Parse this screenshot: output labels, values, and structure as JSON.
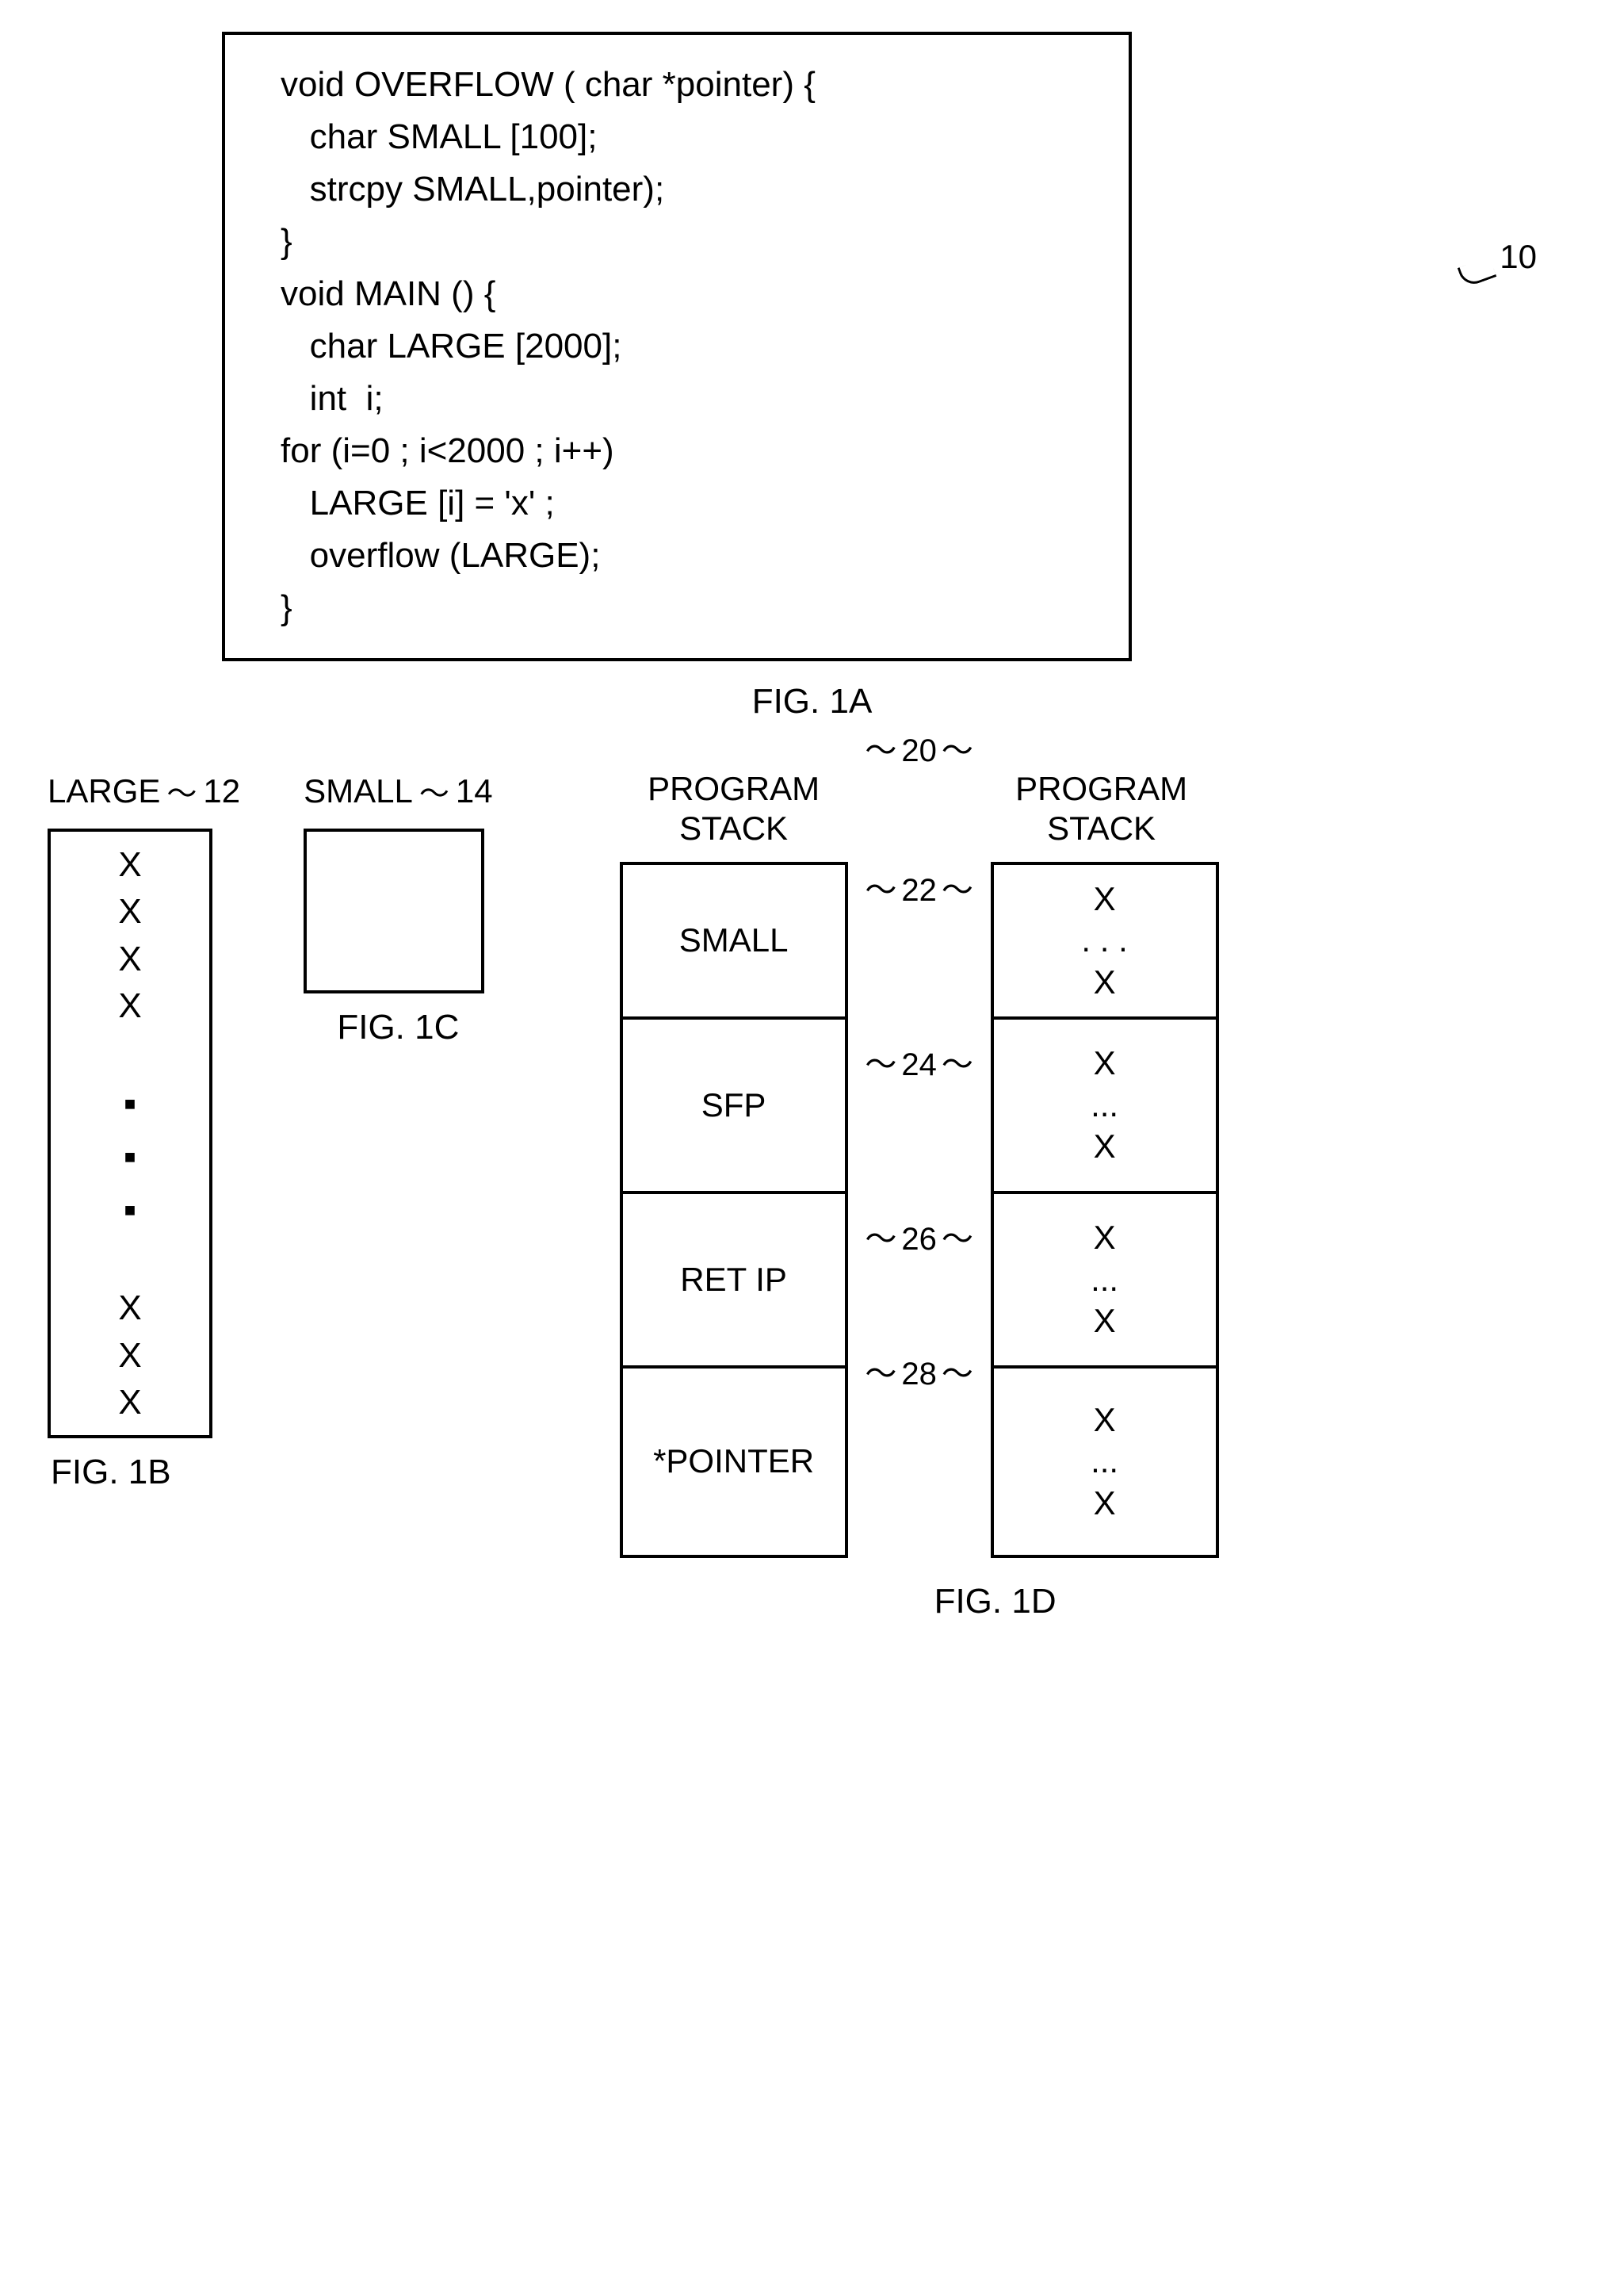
{
  "fig1a": {
    "code": [
      "void OVERFLOW ( char *pointer) {",
      "",
      "   char SMALL [100];",
      "",
      "   strcpy SMALL,pointer);",
      "}",
      "",
      "void MAIN () {",
      "   char LARGE [2000];",
      "   int  i;",
      "",
      "for (i=0 ; i<2000 ; i++)",
      "   LARGE [i] = 'x' ;",
      "   overflow (LARGE);",
      "}"
    ],
    "ref": "10",
    "caption": "FIG. 1A"
  },
  "fig1b": {
    "label": "LARGE",
    "ref": "12",
    "cells_top": [
      "X",
      "X",
      "X",
      "X"
    ],
    "cells_bot": [
      "X",
      "X",
      "X"
    ],
    "caption": "FIG. 1B"
  },
  "fig1c": {
    "label": "SMALL",
    "ref": "14",
    "caption": "FIG. 1C"
  },
  "fig1d": {
    "left_title_l1": "PROGRAM",
    "left_title_l2": "STACK",
    "right_title_l1": "PROGRAM",
    "right_title_l2": "STACK",
    "ref_top": "20",
    "left_cells": [
      "SMALL",
      "SFP",
      "RET IP",
      "*POINTER"
    ],
    "refs": [
      "22",
      "24",
      "26",
      "28"
    ],
    "right_cells": {
      "line_x": "X",
      "line_dots": ". . .",
      "line_dots2": "..."
    },
    "caption": "FIG. 1D"
  }
}
